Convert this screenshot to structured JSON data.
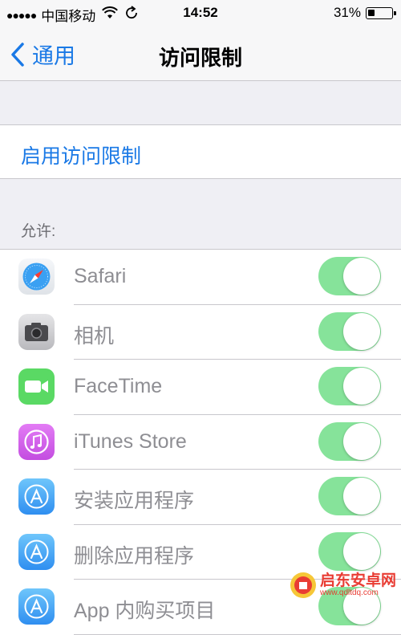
{
  "status_bar": {
    "signal": "●●●●●",
    "carrier": "中国移动",
    "time": "14:52",
    "battery_percent_label": "31%",
    "battery_level": 0.31
  },
  "nav": {
    "back_label": "通用",
    "title": "访问限制"
  },
  "enable_cell": {
    "label": "启用访问限制"
  },
  "section": {
    "header": "允许:"
  },
  "apps": [
    {
      "label": "Safari",
      "icon": "safari-icon",
      "enabled": true
    },
    {
      "label": "相机",
      "icon": "camera-icon",
      "enabled": true
    },
    {
      "label": "FaceTime",
      "icon": "facetime-icon",
      "enabled": true
    },
    {
      "label": "iTunes Store",
      "icon": "itunes-store-icon",
      "enabled": true
    },
    {
      "label": "安装应用程序",
      "icon": "app-store-icon",
      "enabled": true
    },
    {
      "label": "删除应用程序",
      "icon": "app-store-icon",
      "enabled": true
    },
    {
      "label": "App 内购买项目",
      "icon": "app-store-icon",
      "enabled": true
    }
  ],
  "watermark": {
    "title": "启东安卓网",
    "url": "www.qdltdq.com"
  },
  "colors": {
    "accent": "#1a79e6",
    "toggle_on": "#86e39a",
    "background": "#efeff4"
  }
}
